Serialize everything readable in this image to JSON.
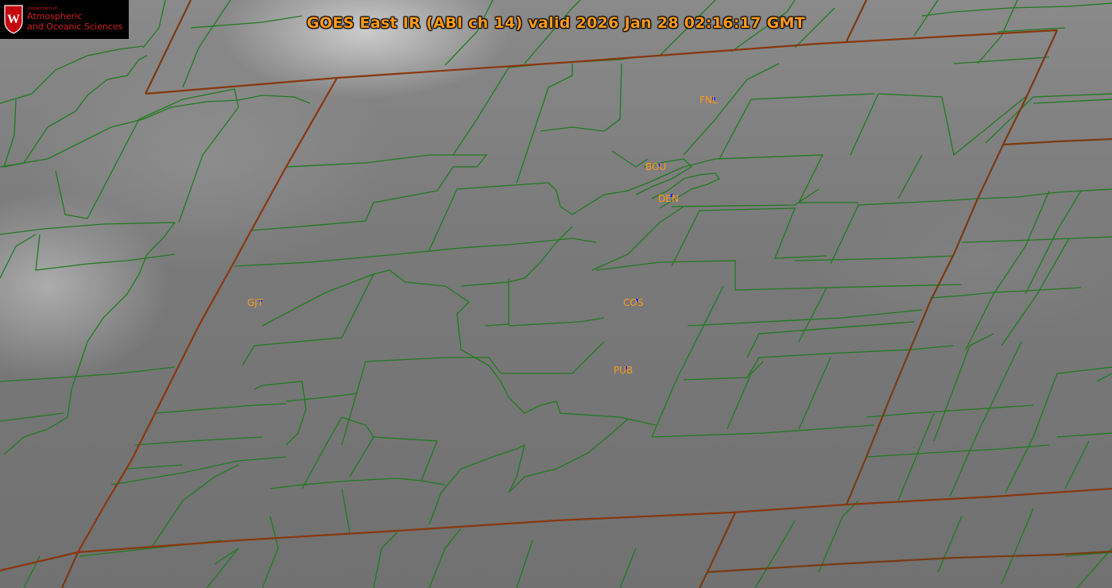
{
  "title": "GOES East IR (ABI ch 14) valid 2026 Jan 28 02:16:17 GMT",
  "logo": {
    "department_label": "Department of",
    "line1": "Atmospheric",
    "line2": "and Oceanic Sciences",
    "shield_letter": "W"
  },
  "stations": [
    {
      "id": "FNL",
      "label": "FNL"
    },
    {
      "id": "BOU",
      "label": "BOU"
    },
    {
      "id": "DEN",
      "label": "DEN"
    },
    {
      "id": "GJT",
      "label": "GJT"
    },
    {
      "id": "COS",
      "label": "COS"
    },
    {
      "id": "PUB",
      "label": "PUB"
    }
  ],
  "colors": {
    "title": "#ff9a1a",
    "station_label": "#ff9a1a",
    "station_marker": "#1030ff",
    "county_line": "#1f7a1f",
    "state_line": "#7a3a10",
    "logo_text": "#d42020"
  }
}
